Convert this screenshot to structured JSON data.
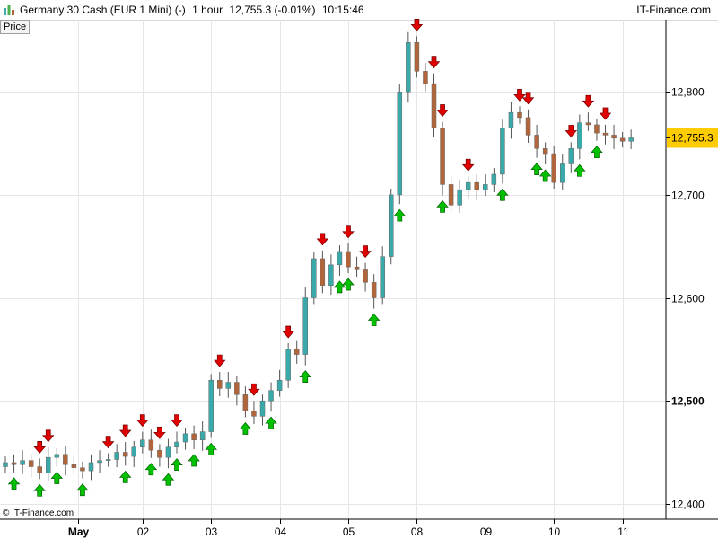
{
  "header": {
    "instrument": "Germany 30 Cash (EUR 1 Mini) (-)",
    "timeframe": "1 hour",
    "last_quote": "12,755.3 (-0.01%)",
    "time": "10:15:46",
    "brand": "IT-Finance.com"
  },
  "panel": {
    "label": "Price"
  },
  "footer": {
    "copyright": "© IT-Finance.com"
  },
  "colors": {
    "up_candle": "#3aa9a9",
    "down_candle": "#b0663a",
    "wick": "#555555",
    "grid": "#e6e6e6",
    "price_badge": "#ffcc00",
    "up_arrow": "#00c000",
    "down_arrow": "#e00000"
  },
  "chart_data": {
    "type": "candlestick",
    "ylim": [
      12385,
      12870
    ],
    "yticks": [
      {
        "value": 12400,
        "label": "12,400"
      },
      {
        "value": 12500,
        "label": "12,500"
      },
      {
        "value": 12600,
        "label": "12,600"
      },
      {
        "value": 12700,
        "label": "12,700"
      },
      {
        "value": 12800,
        "label": "12,800"
      }
    ],
    "xticks": [
      {
        "label": "May",
        "index": 8.5
      },
      {
        "label": "02",
        "index": 16
      },
      {
        "label": "03",
        "index": 24
      },
      {
        "label": "04",
        "index": 32
      },
      {
        "label": "05",
        "index": 40
      },
      {
        "label": "08",
        "index": 48
      },
      {
        "label": "09",
        "index": 56
      },
      {
        "label": "10",
        "index": 64
      },
      {
        "label": "11",
        "index": 72
      }
    ],
    "last_price": {
      "value": 12755.3,
      "label": "12,755.3"
    },
    "closes": [
      12440,
      12438,
      12442,
      12436,
      12430,
      12445,
      12448,
      12438,
      12435,
      12432,
      12440,
      12442,
      12443,
      12450,
      12446,
      12455,
      12462,
      12452,
      12445,
      12455,
      12460,
      12468,
      12462,
      12470,
      12520,
      12512,
      12518,
      12506,
      12490,
      12485,
      12500,
      12510,
      12520,
      12550,
      12545,
      12600,
      12638,
      12612,
      12632,
      12645,
      12630,
      12628,
      12615,
      12600,
      12640,
      12700,
      12800,
      12848,
      12820,
      12808,
      12765,
      12710,
      12690,
      12705,
      12712,
      12705,
      12710,
      12720,
      12765,
      12780,
      12775,
      12758,
      12745,
      12740,
      12712,
      12730,
      12745,
      12770,
      12768,
      12760,
      12758,
      12755,
      12752,
      12755.3
    ],
    "buy_signals": [
      1,
      4,
      6,
      9,
      14,
      17,
      19,
      20,
      22,
      24,
      28,
      31,
      35,
      39,
      40,
      43,
      46,
      51,
      58,
      62,
      63,
      67,
      69
    ],
    "sell_signals": [
      4,
      5,
      12,
      14,
      16,
      18,
      20,
      25,
      29,
      33,
      37,
      40,
      42,
      48,
      50,
      51,
      54,
      60,
      61,
      66,
      68,
      70
    ]
  }
}
